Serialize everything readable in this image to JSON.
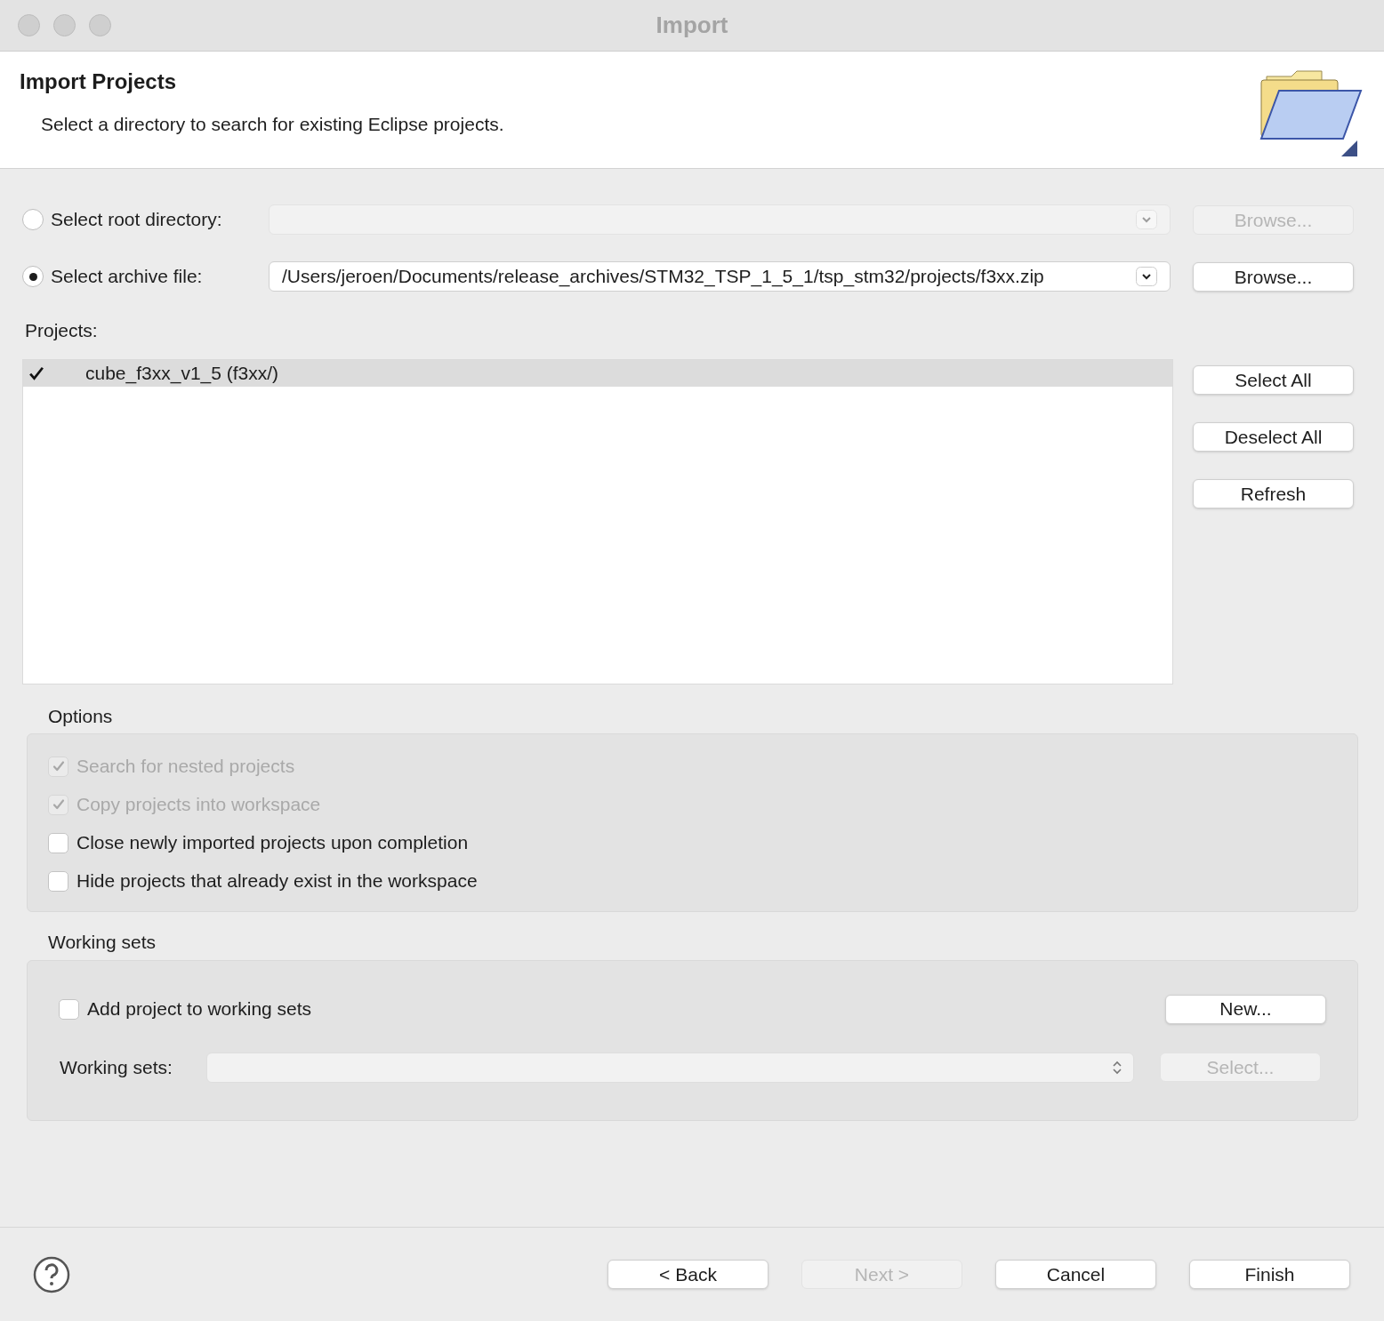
{
  "window": {
    "title": "Import"
  },
  "header": {
    "title": "Import Projects",
    "description": "Select a directory to search for existing Eclipse projects."
  },
  "source": [
    {
      "label": "Select root directory:",
      "selected": false,
      "disabled": true,
      "button": {
        "label": "Browse...",
        "disabled": true
      }
    },
    {
      "label": "Select archive file:",
      "selected": true,
      "disabled": false,
      "value": "/Users/jeroen/Documents/release_archives/STM32_TSP_1_5_1/tsp_stm32/projects/f3xx.zip",
      "button": {
        "label": "Browse...",
        "disabled": false
      }
    }
  ],
  "projects": {
    "label": "Projects:",
    "items": [
      {
        "name": "cube_f3xx_v1_5 (f3xx/)",
        "checked": true,
        "selected": true
      }
    ],
    "buttons": [
      "Select All",
      "Deselect All",
      "Refresh"
    ]
  },
  "options": {
    "title": "Options",
    "items": [
      {
        "label": "Search for nested projects",
        "checked": true,
        "disabled": true
      },
      {
        "label": "Copy projects into workspace",
        "checked": true,
        "disabled": true
      },
      {
        "label": "Close newly imported projects upon completion",
        "checked": false,
        "disabled": false
      },
      {
        "label": "Hide projects that already exist in the workspace",
        "checked": false,
        "disabled": false
      }
    ]
  },
  "working_sets": {
    "title": "Working sets",
    "add": {
      "label": "Add project to working sets",
      "checked": false
    },
    "new_button": {
      "label": "New...",
      "disabled": false
    },
    "field_label": "Working sets:",
    "field_disabled": true,
    "select_button": {
      "label": "Select...",
      "disabled": true
    }
  },
  "footer": {
    "buttons": [
      {
        "label": "< Back",
        "disabled": false
      },
      {
        "label": "Next >",
        "disabled": true
      },
      {
        "label": "Cancel",
        "disabled": false
      },
      {
        "label": "Finish",
        "disabled": false
      }
    ]
  }
}
